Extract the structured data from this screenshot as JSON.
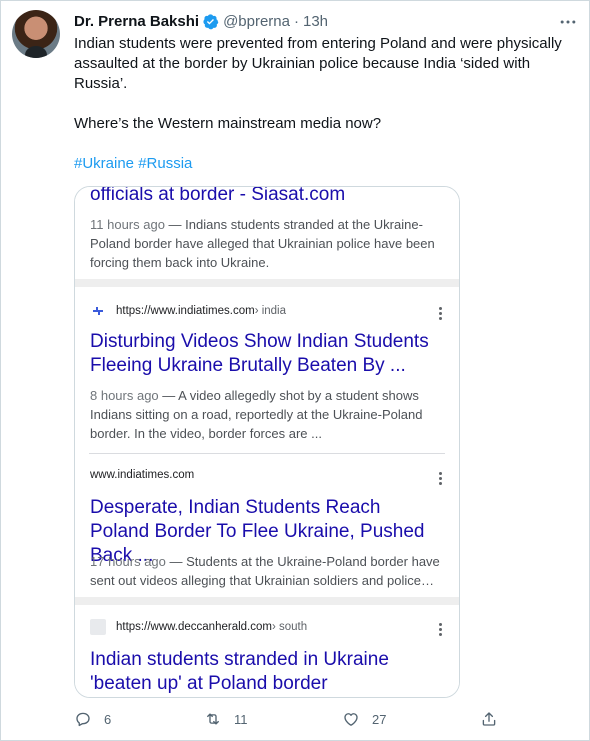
{
  "tweet": {
    "author_name": "Dr. Prerna Bakshi",
    "handle": "@bprerna",
    "separator": "·",
    "time": "13h",
    "text_line1": "Indian students were prevented from entering Poland and were physically assaulted at the border by Ukrainian police because India ‘sided with Russia’.",
    "text_line2": "Where’s the Western mainstream media now?",
    "hashtags": [
      "#Ukraine",
      "#Russia"
    ]
  },
  "search_card": {
    "result1": {
      "title": "officials at border - Siasat.com",
      "date": "11 hours ago",
      "snippet": " — Indians students stranded at the Ukraine-Poland border have alleged that Ukrainian police have been forcing them back into Ukraine."
    },
    "result2": {
      "url": "https://www.indiatimes.com",
      "path": " › india",
      "title": "Disturbing Videos Show Indian Students Fleeing Ukraine Brutally Beaten By ...",
      "date": "8 hours ago",
      "snippet": " — A video allegedly shot by a student shows Indians sitting on a road, reportedly at the Ukraine-Poland border. In the video, border forces are ..."
    },
    "result3": {
      "url": "www.indiatimes.com",
      "title": "Desperate, Indian Students Reach Poland Border To Flee Ukraine, Pushed Back ...",
      "date": "17 hours ago",
      "snippet": " — Students at the Ukraine-Poland border have sent out videos alleging that Ukrainian soldiers and police…"
    },
    "result4": {
      "url": "https://www.deccanherald.com",
      "path": " › south",
      "title": "Indian students stranded in Ukraine 'beaten up' at Poland border"
    }
  },
  "actions": {
    "replies": "6",
    "retweets": "11",
    "likes": "27"
  },
  "colors": {
    "link_blue": "#1d9bf0",
    "google_title": "#1a0dab",
    "verified": "#1d9bf0"
  },
  "icons": [
    "verified-badge-icon",
    "more-icon",
    "reply-icon",
    "retweet-icon",
    "like-icon",
    "share-icon",
    "kebab-menu-icon",
    "site-favicon"
  ]
}
